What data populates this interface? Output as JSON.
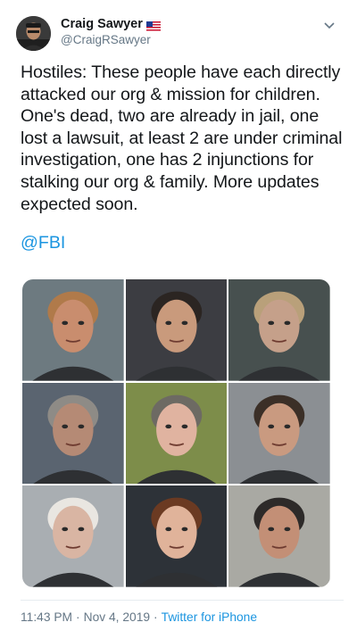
{
  "user": {
    "display_name": "Craig Sawyer",
    "handle": "@CraigRSawyer",
    "verified_flag": "us-flag-icon"
  },
  "tweet": {
    "text": "Hostiles: These people have each directly attacked our org & mission for children. One's dead, two are already in jail, one lost a lawsuit, at least 2 are under criminal investigation, one has 2 injunctions for stalking our org & family. More updates expected soon.",
    "mention": "@FBI"
  },
  "photos": [
    {
      "name": "photo-1",
      "bg": "#6d7a80",
      "skin": "#c98d6e",
      "hair": "#b07a4a"
    },
    {
      "name": "photo-2",
      "bg": "#3c3d42",
      "skin": "#c99a7c",
      "hair": "#2b2522"
    },
    {
      "name": "photo-3",
      "bg": "#47504f",
      "skin": "#c5a08a",
      "hair": "#b9a07a"
    },
    {
      "name": "photo-4",
      "bg": "#5a6470",
      "skin": "#b58a75",
      "hair": "#8e8b86"
    },
    {
      "name": "photo-5",
      "bg": "#7d8d4a",
      "skin": "#e0b3a0",
      "hair": "#6d6a63"
    },
    {
      "name": "photo-6",
      "bg": "#8b8f93",
      "skin": "#c99a80",
      "hair": "#3b2f27"
    },
    {
      "name": "photo-7",
      "bg": "#a9aeb2",
      "skin": "#d9b5a3",
      "hair": "#e9e6e1"
    },
    {
      "name": "photo-8",
      "bg": "#2d3238",
      "skin": "#e0b39a",
      "hair": "#6b3a22"
    },
    {
      "name": "photo-9",
      "bg": "#a9a9a3",
      "skin": "#c38f76",
      "hair": "#2d2a29"
    }
  ],
  "footer": {
    "time": "11:43 PM",
    "sep1": "·",
    "date": "Nov 4, 2019",
    "sep2": "·",
    "source": "Twitter for iPhone"
  },
  "colors": {
    "link": "#1b95e0",
    "muted": "#657786",
    "text": "#14171a"
  }
}
